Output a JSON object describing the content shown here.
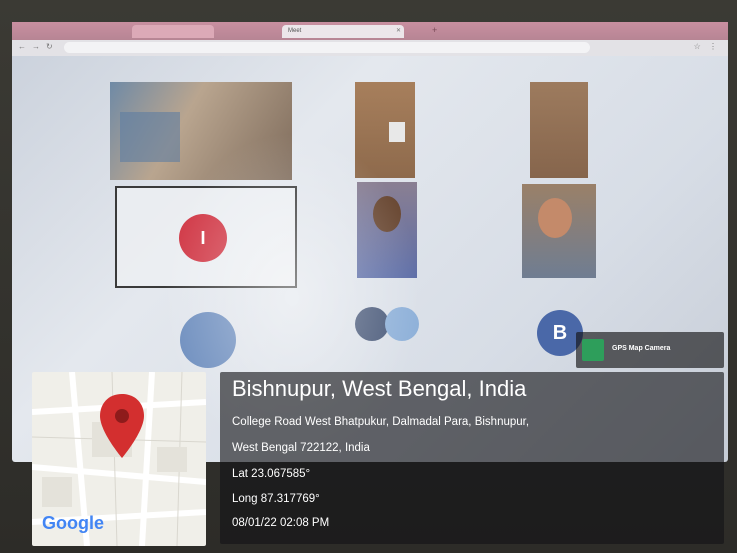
{
  "browser": {
    "tabs": [
      {
        "label": "",
        "active": false
      },
      {
        "label": "Meet",
        "active": true
      }
    ],
    "url": ""
  },
  "meeting": {
    "participants": [
      {
        "caption": ""
      },
      {
        "caption": ""
      },
      {
        "caption": ""
      },
      {
        "caption": "",
        "initial": "I"
      },
      {
        "caption": ""
      },
      {
        "caption": ""
      }
    ],
    "avatar_initial": "B",
    "accent": "#d13a48",
    "avatar_color": "#4a68a8"
  },
  "gps_camera": {
    "app_name": "GPS Map Camera",
    "location_title": "Bishnupur, West Bengal, India",
    "address_line1": "College Road West Bhatpukur, Dalmadal Para, Bishnupur,",
    "address_line2": "West Bengal 722122, India",
    "latitude": "Lat 23.067585°",
    "longitude": "Long 87.317769°",
    "datetime": "08/01/22 02:08 PM",
    "map_provider": "Google",
    "pin_color": "#d32f2f"
  }
}
